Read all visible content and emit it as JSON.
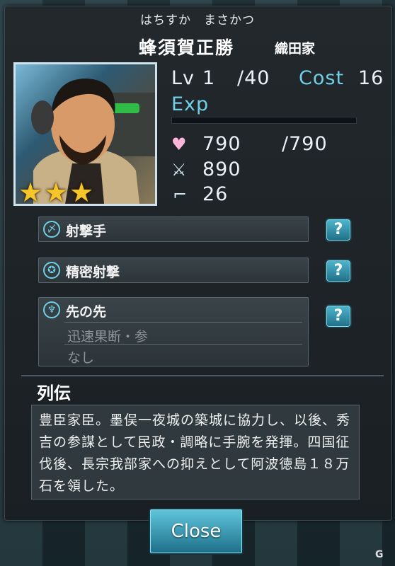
{
  "character": {
    "kana": "はちすか　まさかつ",
    "name": "蜂須賀正勝",
    "clan": "織田家"
  },
  "stats": {
    "lv_label": "Lv",
    "level": "1",
    "max_level": "/40",
    "cost_label": "Cost",
    "cost": "16",
    "exp_label": "Exp",
    "exp_progress": 0.0,
    "hp": "790",
    "hp_max": "/790",
    "attack": "890",
    "speed": "26",
    "rarity_stars": 3
  },
  "skills": [
    {
      "label": "射撃手",
      "icon": "bow-icon"
    },
    {
      "label": "精密射撃",
      "icon": "pentagram-icon"
    },
    {
      "label": "先の先",
      "icon": "figure-icon",
      "sub": [
        "迅速果断・参",
        "なし"
      ]
    }
  ],
  "help_label": "?",
  "bio": {
    "title": "列伝",
    "text": "豊臣家臣。墨俣一夜城の築城に協力し、以後、秀吉の参謀として民政・調略に手腕を発揮。四国征伐後、長宗我部家への抑えとして阿波徳島１８万石を領した。"
  },
  "close_label": "Close",
  "colors": {
    "accent": "#6fd0e6",
    "star": "#f5c52a",
    "heart": "#ffb6d9"
  }
}
